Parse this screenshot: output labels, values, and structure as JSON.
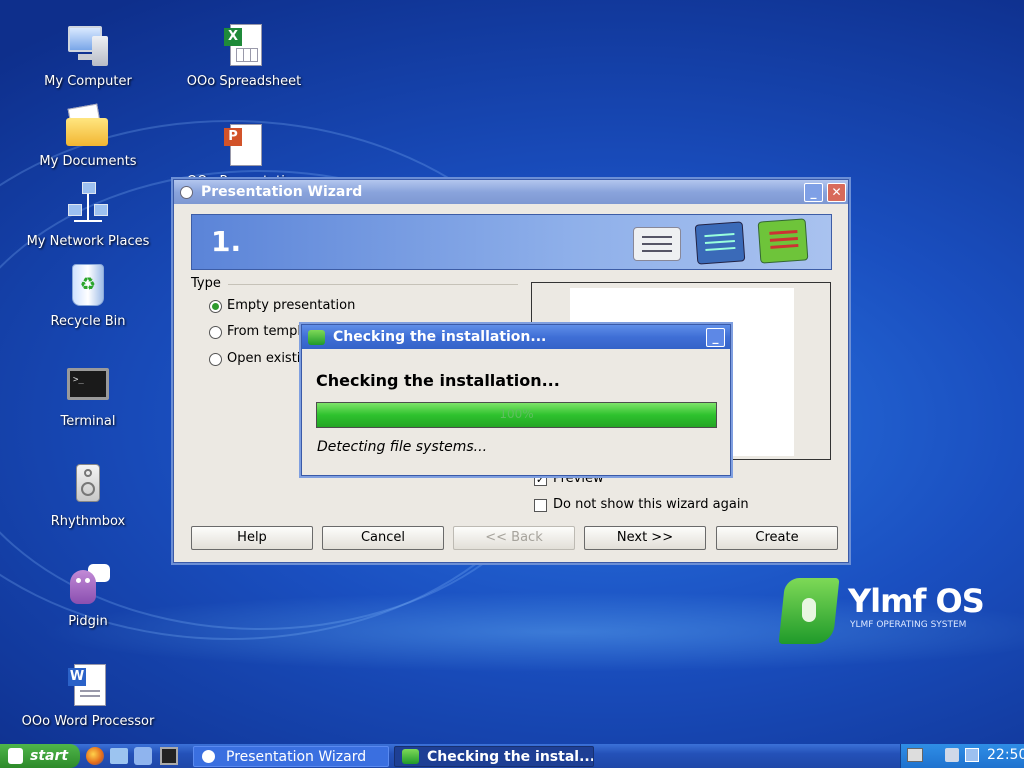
{
  "desktop": {
    "icons": [
      {
        "label": "My Computer"
      },
      {
        "label": "My Documents"
      },
      {
        "label": "My Network Places"
      },
      {
        "label": "Recycle Bin"
      },
      {
        "label": "Terminal"
      },
      {
        "label": "Rhythmbox"
      },
      {
        "label": "Pidgin"
      },
      {
        "label": "OOo Word Processor"
      },
      {
        "label": "OOo Spreadsheet"
      },
      {
        "label": "OOo Presentation"
      }
    ],
    "brand": {
      "name": "Ylmf OS",
      "tagline": "YLMF OPERATING SYSTEM"
    }
  },
  "wizard": {
    "title": "Presentation Wizard",
    "step": "1.",
    "type_label": "Type",
    "options": [
      "Empty presentation",
      "From template",
      "Open existing presentation"
    ],
    "selected_option": "Empty presentation",
    "preview_label": "Preview",
    "preview_checked": true,
    "dont_show_label": "Do not show this wizard again",
    "dont_show_checked": false,
    "buttons": {
      "help": "Help",
      "cancel": "Cancel",
      "back": "<< Back",
      "next": "Next >>",
      "create": "Create"
    }
  },
  "dialog": {
    "title": "Checking the installation...",
    "heading": "Checking the installation...",
    "progress_text": "100%",
    "progress": 1.0,
    "status": "Detecting file systems...",
    "logo_text": "Ylmf OS"
  },
  "taskbar": {
    "start_label": "start",
    "tasks": [
      "Presentation Wizard",
      "Checking the instal..."
    ],
    "clock": "22:50"
  },
  "colors": {
    "title_active": "#3f6fd6",
    "title_inactive": "#8fa6d8",
    "progress_green": "#2ec22e",
    "taskbar": "#2451b8"
  }
}
